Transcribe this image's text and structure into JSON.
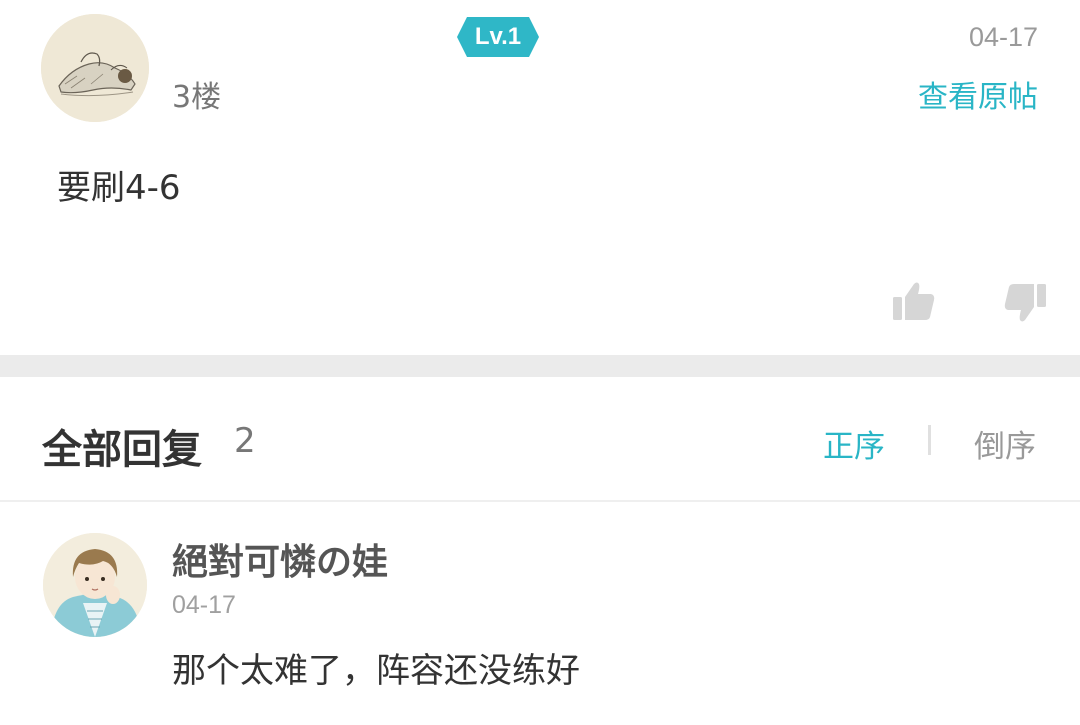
{
  "post": {
    "level_badge": "Lv.1",
    "date": "04-17",
    "floor": "3楼",
    "view_original": "查看原帖",
    "content": "要刷4-6"
  },
  "replies_header": {
    "title": "全部回复",
    "count": "2",
    "sort_asc": "正序",
    "sort_desc": "倒序"
  },
  "reply": {
    "username": "絕對可憐の娃",
    "date": "04-17",
    "content": "那个太难了，阵容还没练好"
  },
  "colors": {
    "accent": "#29b5c6",
    "separator": "#ebebeb",
    "muted_text": "#999999"
  },
  "icons": {
    "thumb_up": "thumbs-up-icon",
    "thumb_down": "thumbs-down-icon"
  }
}
